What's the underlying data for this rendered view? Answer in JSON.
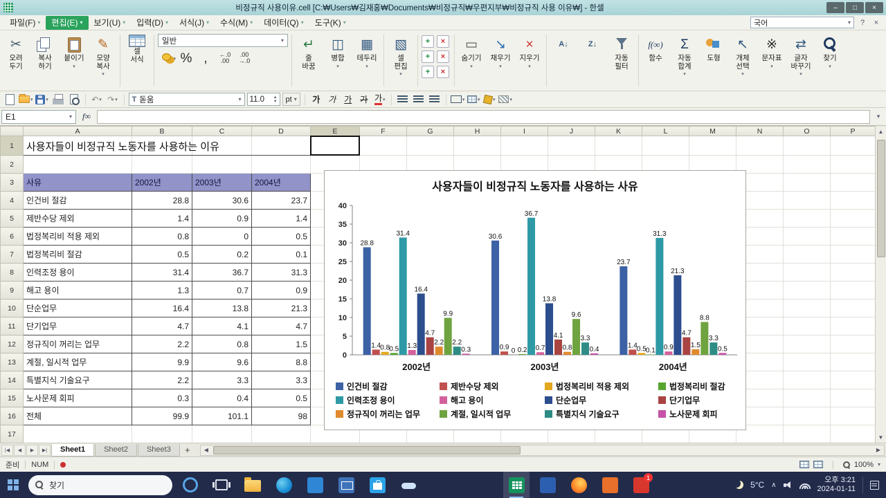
{
  "window": {
    "title": "비정규직 사용이유.cell [C:₩Users₩김재홍₩Documents₩비정규직₩우편지부₩비정규직 사용 이유₩] - 한셀",
    "controls": [
      {
        "name": "minimize-button",
        "glyph": "–"
      },
      {
        "name": "maximize-button",
        "glyph": "□"
      },
      {
        "name": "close-button",
        "glyph": "×"
      }
    ]
  },
  "menu": {
    "items": [
      "파일(F)",
      "편집(E)",
      "보기(U)",
      "입력(D)",
      "서식(J)",
      "수식(M)",
      "데이터(Q)",
      "도구(K)"
    ],
    "item_names": [
      "file",
      "edit",
      "view",
      "input",
      "format",
      "formula",
      "data",
      "tools"
    ],
    "active": "편집(E)",
    "language": "국어",
    "help_label": "?",
    "close_label": "×"
  },
  "toolbar": {
    "number_format": "일반",
    "groups": [
      {
        "items": [
          {
            "name": "cut-button",
            "icon": "scissors-icon",
            "glyph": "✂",
            "color": "#3e5871",
            "label": "오려\n두기"
          },
          {
            "name": "copy-button",
            "icon": "copy-icon",
            "css": "i-copy",
            "label": "복사\n하기"
          },
          {
            "name": "paste-button",
            "icon": "paste-icon",
            "css": "i-paste",
            "label": "붙이기",
            "arrow": true
          },
          {
            "name": "format-painter-button",
            "icon": "format-painter-icon",
            "glyph": "✎",
            "color": "#b5651d",
            "label": "모양\n복사",
            "arrow": true
          }
        ]
      },
      {
        "items": [
          {
            "name": "cell-format-button",
            "icon": "cell-format-icon",
            "css": "i-grid",
            "label": "셀\n서식"
          }
        ]
      },
      {
        "type": "number",
        "combo_name": "number-format-select",
        "items": [
          {
            "name": "currency-button",
            "icon": "coins-icon",
            "css": "i-coins",
            "arrow": true
          },
          {
            "name": "percent-button",
            "icon": "percent-icon",
            "glyph": "%",
            "color": "#2a2a2a"
          },
          {
            "name": "comma-button",
            "icon": "comma-icon",
            "glyph": ",",
            "color": "#2a2a2a"
          },
          {
            "name": "increase-decimal-button",
            "icon": "increase-decimal-icon",
            "glyph": "←.0\n.00",
            "color": "#2a2a2a",
            "small": true
          },
          {
            "name": "decrease-decimal-button",
            "icon": "decrease-decimal-icon",
            "glyph": ".00\n→.0",
            "color": "#2a2a2a",
            "small": true
          }
        ]
      },
      {
        "items": [
          {
            "name": "wrap-text-button",
            "icon": "wrap-text-icon",
            "glyph": "↵",
            "color": "#2d7d46",
            "label": "줄\n바꿈"
          },
          {
            "name": "merge-cells-button",
            "icon": "merge-cells-icon",
            "glyph": "◫",
            "color": "#33597f",
            "label": "병합",
            "arrow": true
          },
          {
            "name": "borders-button",
            "icon": "borders-icon",
            "glyph": "▦",
            "color": "#33597f",
            "label": "테두리",
            "arrow": true
          }
        ]
      },
      {
        "items": [
          {
            "name": "cell-edit-button",
            "icon": "cell-edit-icon",
            "glyph": "▧",
            "color": "#33597f",
            "label": "셀\n편집",
            "arrow": true
          }
        ]
      },
      {
        "type": "insdel",
        "items": [
          {
            "name": "insert-row-button",
            "icon": "insert-row-icon",
            "kind": "plus"
          },
          {
            "name": "delete-row-button",
            "icon": "delete-row-icon",
            "kind": "x"
          },
          {
            "name": "insert-column-button",
            "icon": "insert-column-icon",
            "kind": "plus"
          },
          {
            "name": "delete-column-button",
            "icon": "delete-column-icon",
            "kind": "x"
          },
          {
            "name": "insert-cells-button",
            "icon": "insert-cells-icon",
            "kind": "plus"
          },
          {
            "name": "delete-cells-button",
            "icon": "delete-cells-icon",
            "kind": "x"
          }
        ]
      },
      {
        "items": [
          {
            "name": "hide-button",
            "icon": "hide-icon",
            "glyph": "▭",
            "color": "#555555",
            "label": "숨기기",
            "arrow": true
          },
          {
            "name": "fill-button",
            "icon": "fill-handle-icon",
            "glyph": "↘",
            "color": "#2a6fb0",
            "label": "채우기",
            "arrow": true
          },
          {
            "name": "erase-button",
            "icon": "eraser-icon",
            "glyph": "×",
            "color": "#cc3333",
            "label": "지우기",
            "arrow": true
          }
        ]
      },
      {
        "items": [
          {
            "name": "sort-ascending-button",
            "icon": "sort-ascending-icon",
            "glyph": "A↓",
            "color": "#33597f",
            "sort": true
          },
          {
            "name": "sort-descending-button",
            "icon": "sort-descending-icon",
            "glyph": "Z↓",
            "color": "#33597f",
            "sort": true
          },
          {
            "name": "auto-filter-button",
            "icon": "filter-icon",
            "css": "i-funnel",
            "label": "자동\n필터"
          }
        ]
      },
      {
        "items": [
          {
            "name": "function-button",
            "icon": "function-icon",
            "glyph": "f(∞)",
            "color": "#1f3a5f",
            "fx": true,
            "label": "함수"
          },
          {
            "name": "autosum-button",
            "icon": "sigma-icon",
            "glyph": "Σ",
            "color": "#1f3a5f",
            "label": "자동\n합계",
            "arrow": true
          },
          {
            "name": "shapes-button",
            "icon": "shapes-icon",
            "css": "i-shapes",
            "label": "도형"
          },
          {
            "name": "object-select-button",
            "icon": "object-select-icon",
            "glyph": "↖",
            "color": "#33597f",
            "label": "개체\n선택",
            "arrow": true
          },
          {
            "name": "char-map-button",
            "icon": "char-map-icon",
            "glyph": "※",
            "color": "#2a2a2a",
            "label": "문자표",
            "arrow": true
          },
          {
            "name": "replace-button",
            "icon": "replace-icon",
            "glyph": "⇄",
            "color": "#33597f",
            "label": "글자\n바꾸기",
            "arrow": true
          },
          {
            "name": "find-button",
            "icon": "find-icon",
            "css": "i-find",
            "label": "찾기",
            "arrow": true
          }
        ]
      }
    ]
  },
  "format_toolbar": {
    "font": "돋움",
    "size": "11.0",
    "unit": "pt",
    "items": [
      {
        "name": "new-document-button",
        "icon": "new-document-icon",
        "css": "i-page"
      },
      {
        "name": "open-button",
        "icon": "open-folder-icon",
        "css": "i-folder",
        "arrow": true
      },
      {
        "name": "save-button",
        "icon": "save-icon",
        "css": "i-floppy",
        "arrow": true
      },
      {
        "name": "print-button",
        "icon": "printer-icon",
        "css": "i-print"
      },
      {
        "name": "preview-button",
        "icon": "preview-icon",
        "css": "i-preview"
      },
      {
        "type": "divider"
      },
      {
        "name": "undo-button",
        "icon": "undo-icon",
        "glyph": "↶",
        "color": "#8a8a84",
        "arrow": true
      },
      {
        "name": "redo-button",
        "icon": "redo-icon",
        "glyph": "↷",
        "color": "#8a8a84",
        "arrow": true
      },
      {
        "type": "divider"
      },
      {
        "type": "font"
      },
      {
        "type": "size"
      },
      {
        "type": "divider"
      },
      {
        "name": "bold-button",
        "icon": "bold-icon",
        "glyph": "가",
        "cls": "f-b"
      },
      {
        "name": "italic-button",
        "icon": "italic-icon",
        "glyph": "가",
        "cls": "f-i"
      },
      {
        "name": "underline-button",
        "icon": "underline-icon",
        "glyph": "가",
        "cls": "f-u"
      },
      {
        "name": "strike-button",
        "icon": "strikethrough-icon",
        "glyph": "가",
        "cls": "f-s"
      },
      {
        "name": "font-color-button",
        "icon": "font-color-icon",
        "glyph": "가",
        "cls": "f-c",
        "arrow": true
      },
      {
        "type": "divider"
      },
      {
        "name": "align-left-button",
        "icon": "align-left-icon",
        "css": "i-al"
      },
      {
        "name": "align-center-button",
        "icon": "align-center-icon",
        "css": "i-ac"
      },
      {
        "name": "align-right-button",
        "icon": "align-right-icon",
        "css": "i-ar"
      },
      {
        "type": "divider"
      },
      {
        "name": "merge-center-button",
        "icon": "merge-center-icon",
        "css": "i-merge2",
        "arrow": true
      },
      {
        "name": "table-button",
        "icon": "table-icon",
        "css": "i-grid2",
        "arrow": true
      },
      {
        "name": "fill-color-button",
        "icon": "fill-color-icon",
        "css": "i-bucket",
        "arrow": true
      },
      {
        "name": "pattern-button",
        "icon": "pattern-icon",
        "css": "i-pattern",
        "arrow": true
      }
    ]
  },
  "formula_bar": {
    "name_box": "E1",
    "fx_label": "f∞",
    "formula": ""
  },
  "sheet": {
    "columns": [
      "A",
      "B",
      "C",
      "D",
      "E",
      "F",
      "G",
      "H",
      "I",
      "J",
      "K",
      "L",
      "M",
      "N",
      "O",
      "P"
    ],
    "selected_column": "E",
    "selected_row": 1,
    "active_cell": "E1",
    "table": {
      "title": "사용자들이 비정규직 노동자를 사용하는 이유",
      "headers": [
        "사유",
        "2002년",
        "2003년",
        "2004년"
      ],
      "rows": [
        [
          "인건비 절감",
          "28.8",
          "30.6",
          "23.7"
        ],
        [
          "제반수당 제외",
          "1.4",
          "0.9",
          "1.4"
        ],
        [
          "법정복리비 적용 제외",
          "0.8",
          "0",
          "0.5"
        ],
        [
          "법정복리비 절감",
          "0.5",
          "0.2",
          "0.1"
        ],
        [
          "인력조정 용이",
          "31.4",
          "36.7",
          "31.3"
        ],
        [
          "해고 용이",
          "1.3",
          "0.7",
          "0.9"
        ],
        [
          "단순업무",
          "16.4",
          "13.8",
          "21.3"
        ],
        [
          "단기업무",
          "4.7",
          "4.1",
          "4.7"
        ],
        [
          "정규직이 꺼리는 업무",
          "2.2",
          "0.8",
          "1.5"
        ],
        [
          "계절, 일시적 업무",
          "9.9",
          "9.6",
          "8.8"
        ],
        [
          "특별지식 기술요구",
          "2.2",
          "3.3",
          "3.3"
        ],
        [
          "노사문제 회피",
          "0.3",
          "0.4",
          "0.5"
        ],
        [
          "전체",
          "99.9",
          "101.1",
          "98"
        ]
      ]
    },
    "tabs": {
      "nav": [
        "|◀",
        "◀",
        "▶",
        "▶|"
      ],
      "items": [
        "Sheet1",
        "Sheet2",
        "Sheet3"
      ],
      "active": "Sheet1",
      "add_label": "+"
    }
  },
  "chart_data": {
    "type": "bar",
    "title": "사용자들이 비정규직 노동자를 사용하는 사유",
    "categories": [
      "2002년",
      "2003년",
      "2004년"
    ],
    "series": [
      {
        "name": "인건비 절감",
        "color": "#3C61A5",
        "values": [
          28.8,
          30.6,
          23.7
        ]
      },
      {
        "name": "제반수당 제외",
        "color": "#C0504D",
        "values": [
          1.4,
          0.9,
          1.4
        ]
      },
      {
        "name": "법정복리비 적용 제외",
        "color": "#E3A820",
        "values": [
          0.8,
          0,
          0.5
        ]
      },
      {
        "name": "법정복리비 절감",
        "color": "#55A630",
        "values": [
          0.5,
          0.2,
          0.1
        ]
      },
      {
        "name": "인력조정 용이",
        "color": "#2E9AA6",
        "values": [
          31.4,
          36.7,
          31.3
        ]
      },
      {
        "name": "해고 용이",
        "color": "#D4619D",
        "values": [
          1.3,
          0.7,
          0.9
        ]
      },
      {
        "name": "단순업무",
        "color": "#2D4E8E",
        "values": [
          16.4,
          13.8,
          21.3
        ]
      },
      {
        "name": "단기업무",
        "color": "#A94442",
        "values": [
          4.7,
          4.1,
          4.7
        ]
      },
      {
        "name": "정규직이 꺼리는 업무",
        "color": "#E08A2E",
        "values": [
          2.2,
          0.8,
          1.5
        ]
      },
      {
        "name": "계절, 일시적 업무",
        "color": "#6FA33F",
        "values": [
          9.9,
          9.6,
          8.8
        ]
      },
      {
        "name": "특별지식 기술요구",
        "color": "#2E8C85",
        "values": [
          2.2,
          3.3,
          3.3
        ]
      },
      {
        "name": "노사문제 회피",
        "color": "#C653A8",
        "values": [
          0.3,
          0.4,
          0.5
        ]
      }
    ],
    "ylim": [
      0,
      40
    ],
    "yticks": [
      0,
      5,
      10,
      15,
      20,
      25,
      30,
      35,
      40
    ],
    "legend_position": "bottom",
    "data_labels": true,
    "grid": false
  },
  "status_bar": {
    "mode": "준비",
    "num_lock": "NUM",
    "zoom": "100%"
  },
  "taskbar": {
    "search_placeholder": "찾기",
    "apps": [
      {
        "name": "cortana-icon",
        "style": "cortana"
      },
      {
        "name": "task-view-icon",
        "style": "taskview"
      },
      {
        "name": "file-explorer-icon",
        "style": "folder"
      },
      {
        "name": "edge-icon",
        "style": "edge"
      },
      {
        "name": "photos-icon",
        "style": "photos"
      },
      {
        "name": "mail-icon",
        "style": "mail"
      },
      {
        "name": "store-icon",
        "style": "store"
      },
      {
        "name": "onedrive-icon",
        "style": "onedrive"
      },
      {
        "name": "hancell-icon",
        "style": "hancell",
        "active": true
      },
      {
        "name": "hword-icon",
        "style": "hword"
      },
      {
        "name": "firefox-icon",
        "style": "firefox"
      },
      {
        "name": "hanshow-icon",
        "style": "hanshow"
      },
      {
        "name": "update-icon",
        "style": "updater",
        "badge": "1"
      }
    ],
    "tray": {
      "temperature": "5°C",
      "time": "오후 3:21",
      "date": "2024-01-11"
    }
  }
}
